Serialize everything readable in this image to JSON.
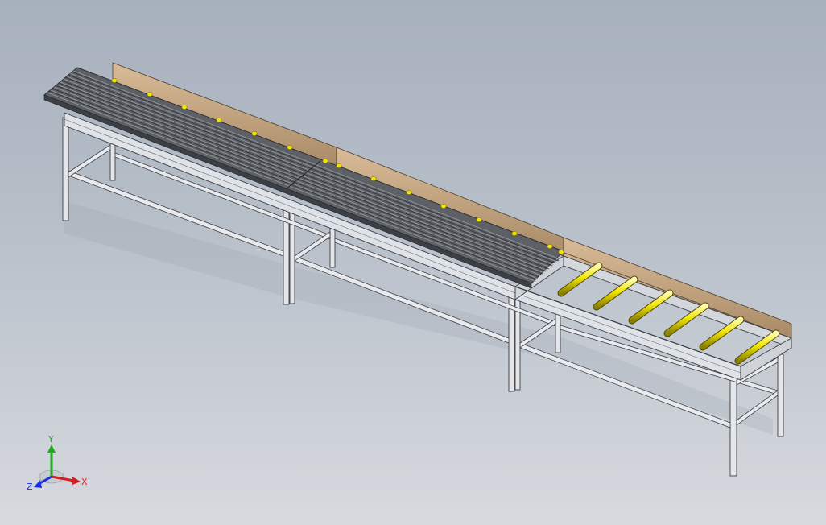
{
  "viewport": {
    "background_top": "#a7b0bd",
    "background_bottom": "#d7dadf"
  },
  "model": {
    "frame_color": "#dfe2e6",
    "frame_edge": "#3a3f47",
    "deck_color": "#6b6f74",
    "roller_color": "#f2e600",
    "guard_color": "#c9a882"
  },
  "triad": {
    "x_label": "X",
    "y_label": "Y",
    "z_label": "Z",
    "x_color": "#d32020",
    "y_color": "#18b018",
    "z_color": "#1a2fe0"
  }
}
